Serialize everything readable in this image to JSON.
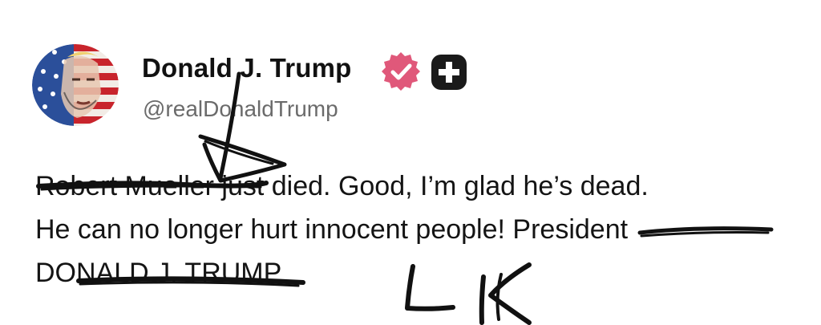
{
  "post": {
    "author_name": "Donald J. Trump",
    "handle": "@realDonaldTrump",
    "body_lines": [
      "Robert Mueller just died. Good, I’m glad he’s dead.",
      "He can no longer hurt innocent people! President",
      "DONALD J. TRUMP"
    ]
  },
  "badges": {
    "verified_icon": "verified-check-icon",
    "plus_icon": "plus-icon",
    "verified_color": "#e0587a"
  },
  "handwriting": {
    "initials": "LK"
  }
}
